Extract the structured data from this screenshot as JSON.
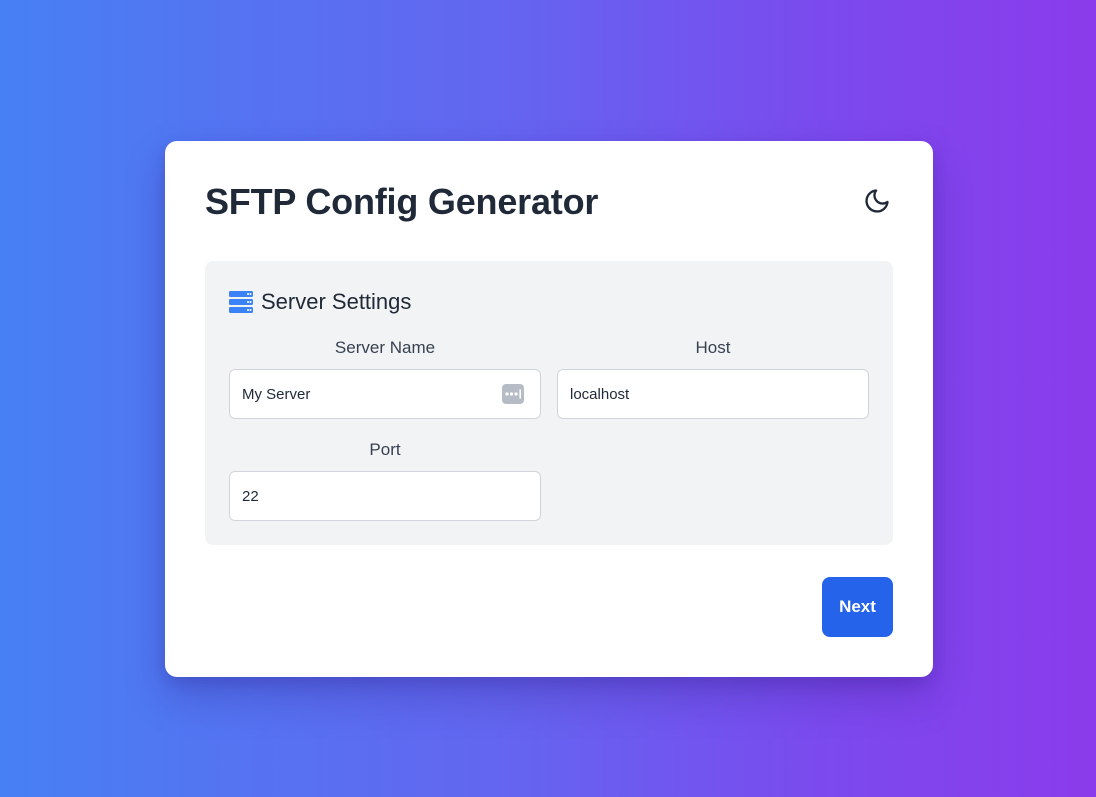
{
  "app": {
    "title": "SFTP Config Generator",
    "theme_toggle_icon": "moon-icon"
  },
  "server_settings": {
    "section_title": "Server Settings",
    "section_icon": "server-icon",
    "fields": {
      "server_name": {
        "label": "Server Name",
        "value": "My Server",
        "trailing_icon": "password-manager-icon"
      },
      "host": {
        "label": "Host",
        "value": "localhost"
      },
      "port": {
        "label": "Port",
        "value": "22"
      }
    }
  },
  "actions": {
    "next_label": "Next"
  },
  "colors": {
    "accent": "#2563eb",
    "gradient_start": "#4780f4",
    "gradient_end": "#8b3beb",
    "panel_bg": "#f2f3f5",
    "section_icon": "#3b82f6"
  }
}
